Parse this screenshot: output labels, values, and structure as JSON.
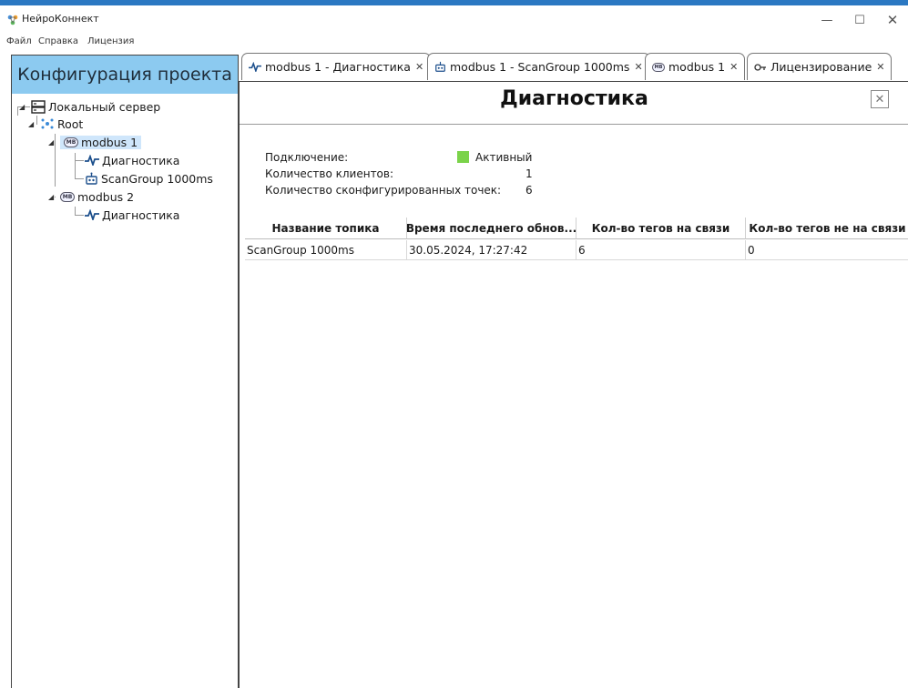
{
  "window": {
    "title": "НейроКоннект",
    "controls": {
      "minimize": "—",
      "maximize": "☐",
      "close": "✕"
    }
  },
  "menu": [
    "Файл",
    "Справка",
    "Лицензия"
  ],
  "left_panel": {
    "header": "Конфигурация проекта",
    "tree": {
      "server": "Локальный сервер",
      "root": "Root",
      "node1": "modbus 1",
      "node1_diag": "Диагностика",
      "node1_scan": "ScanGroup 1000ms",
      "node2": "modbus 2",
      "node2_diag": "Диагностика",
      "badge": "MB"
    }
  },
  "tabs": [
    {
      "label": "modbus 1 - Диагностика",
      "icon": "pulse-icon",
      "close": "✕"
    },
    {
      "label": "modbus 1 - ScanGroup 1000ms",
      "icon": "robot-icon",
      "close": "✕"
    },
    {
      "label": "modbus 1",
      "icon": "modbus-icon",
      "close": "✕"
    },
    {
      "label": "Лицензирование",
      "icon": "key-icon",
      "close": "✕"
    }
  ],
  "diagnostics": {
    "title": "Диагностика",
    "close_glyph": "✕",
    "connection_label": "Подключение:",
    "connection_value": "Активный",
    "connection_color": "#7bd34a",
    "clients_label": "Количество клиентов:",
    "clients_value": "1",
    "points_label": "Количество сконфигурированных точек:",
    "points_value": "6"
  },
  "table": {
    "columns": [
      "Название топика",
      "Время последнего обнов...",
      "Кол-во тегов на связи",
      "Кол-во тегов не на связи"
    ],
    "rows": [
      [
        "ScanGroup 1000ms",
        "30.05.2024, 17:27:42",
        "6",
        "0"
      ]
    ]
  },
  "colors": {
    "panel_header": "#8ccaf0",
    "selection": "#cfe6fb",
    "accent": "#2b78c2"
  }
}
